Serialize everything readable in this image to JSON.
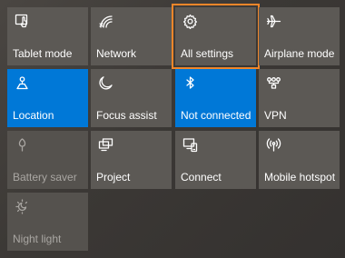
{
  "quick_actions": {
    "tablet_mode": {
      "label": "Tablet mode",
      "icon": "tablet-mode-icon",
      "state": "off"
    },
    "network": {
      "label": "Network",
      "icon": "network-icon",
      "state": "off"
    },
    "all_settings": {
      "label": "All settings",
      "icon": "gear-icon",
      "state": "highlighted"
    },
    "airplane_mode": {
      "label": "Airplane mode",
      "icon": "airplane-icon",
      "state": "off"
    },
    "location": {
      "label": "Location",
      "icon": "location-icon",
      "state": "on"
    },
    "focus_assist": {
      "label": "Focus assist",
      "icon": "moon-icon",
      "state": "off"
    },
    "bluetooth": {
      "label": "Not connected",
      "icon": "bluetooth-icon",
      "state": "on"
    },
    "vpn": {
      "label": "VPN",
      "icon": "vpn-icon",
      "state": "off"
    },
    "battery_saver": {
      "label": "Battery saver",
      "icon": "battery-saver-icon",
      "state": "disabled"
    },
    "project": {
      "label": "Project",
      "icon": "project-icon",
      "state": "off"
    },
    "connect": {
      "label": "Connect",
      "icon": "connect-icon",
      "state": "off"
    },
    "mobile_hotspot": {
      "label": "Mobile hotspot",
      "icon": "mobile-hotspot-icon",
      "state": "off"
    },
    "night_light": {
      "label": "Night light",
      "icon": "night-light-icon",
      "state": "disabled"
    }
  },
  "colors": {
    "tile_background": "#5c5955",
    "active_background": "#0078d7",
    "highlight_outline": "#f0862a",
    "disabled_text": "#a9a6a2"
  }
}
